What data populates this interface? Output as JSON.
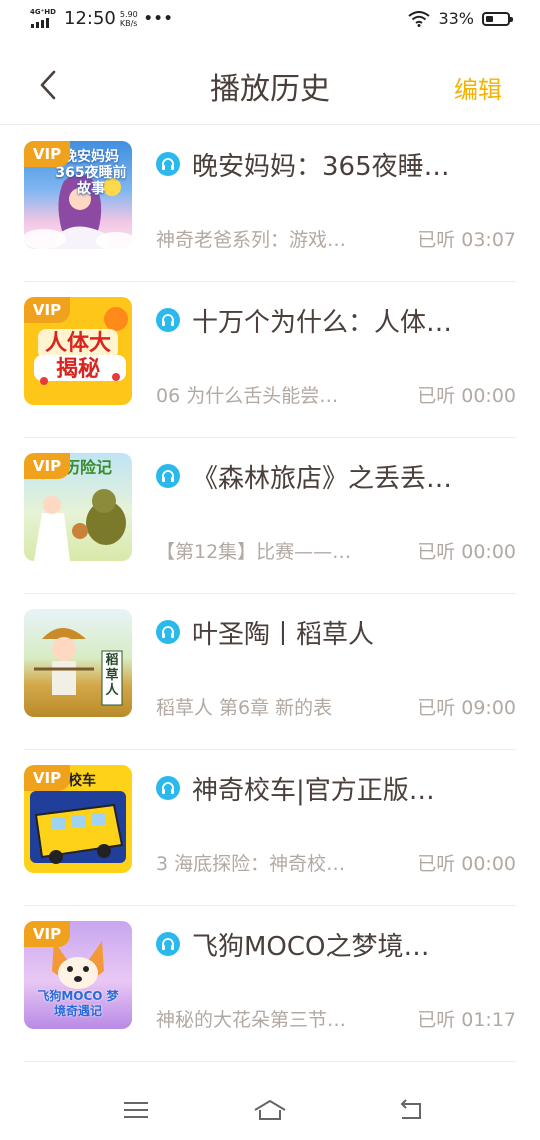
{
  "status_bar": {
    "network": "4G⁺HD",
    "time": "12:50",
    "speed_value": "5.90",
    "speed_unit": "KB/s",
    "more": "•••",
    "battery_percent": "33%"
  },
  "header": {
    "title": "播放历史",
    "edit_label": "编辑"
  },
  "vip_label": "VIP",
  "items": [
    {
      "title": "晚安妈妈：365夜睡…",
      "subtitle": "神奇老爸系列：游戏…",
      "progress": "已听 03:07",
      "cover_text": "晚安妈妈 365夜睡前故事",
      "vip": true
    },
    {
      "title": "十万个为什么：人体…",
      "subtitle": "06 为什么舌头能尝…",
      "progress": "已听 00:00",
      "cover_text": "人体大揭秘",
      "vip": true
    },
    {
      "title": "《森林旅店》之丢丢…",
      "subtitle": "【第12集】比赛——…",
      "progress": "已听 00:00",
      "cover_text": "历险记",
      "vip": true
    },
    {
      "title": "叶圣陶丨稻草人",
      "subtitle": "稻草人 第6章 新的表",
      "progress": "已听 09:00",
      "cover_text": "稻草人",
      "vip": false
    },
    {
      "title": "神奇校车|官方正版…",
      "subtitle": "3 海底探险：神奇校…",
      "progress": "已听 00:00",
      "cover_text": "校车",
      "vip": true
    },
    {
      "title": "飞狗MOCO之梦境…",
      "subtitle": "神秘的大花朵第三节…",
      "progress": "已听 01:17",
      "cover_text": "飞狗MOCO 梦境奇遇记",
      "vip": true
    }
  ],
  "colors": {
    "accent": "#f5b300",
    "audio_icon": "#2bb9ec",
    "vip_badge": "#f0a21d"
  }
}
